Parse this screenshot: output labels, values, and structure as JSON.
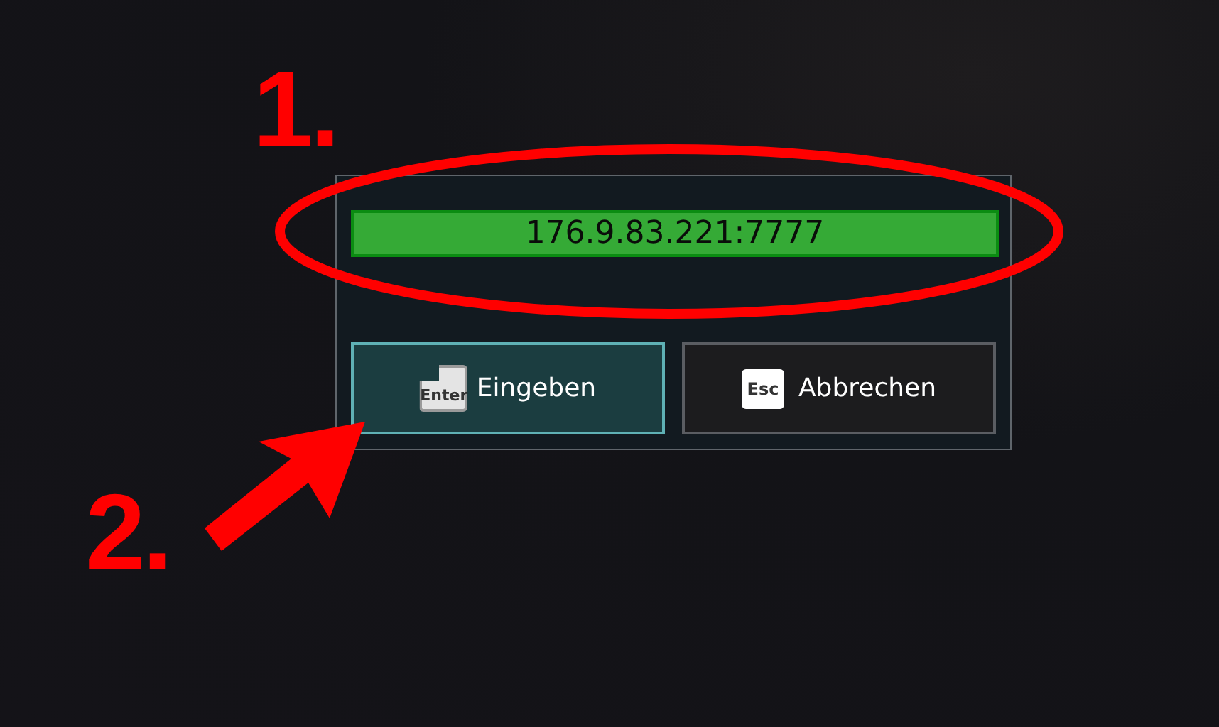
{
  "address_field": {
    "value": "176.9.83.221:7777"
  },
  "buttons": [
    {
      "key": "Enter",
      "label": "Eingeben",
      "selected": true
    },
    {
      "key": "Esc",
      "label": "Abbrechen",
      "selected": false
    }
  ],
  "annotations": [
    {
      "kind": "label",
      "text": "1."
    },
    {
      "kind": "ellipse"
    },
    {
      "kind": "arrow"
    },
    {
      "kind": "label",
      "text": "2."
    }
  ]
}
